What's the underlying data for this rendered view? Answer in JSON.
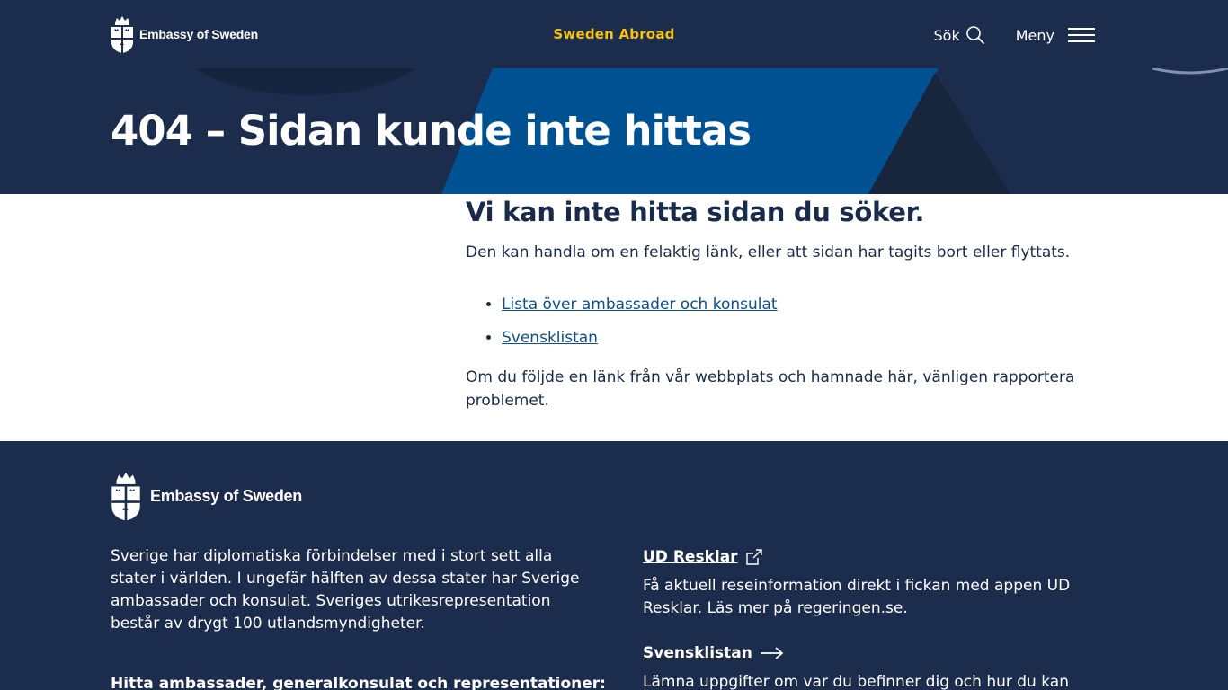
{
  "header": {
    "brand_name": "Embassy of Sweden",
    "center_link": "Sweden Abroad",
    "search_label": "Sök",
    "menu_label": "Meny"
  },
  "hero": {
    "title": "404 – Sidan kunde inte hittas"
  },
  "main": {
    "heading": "Vi kan inte hitta sidan du söker.",
    "lead": "Den kan handla om en felaktig länk, eller att sidan har tagits bort eller flyttats.",
    "links": [
      {
        "label": "Lista över ambassader och konsulat"
      },
      {
        "label": "Svensklistan"
      }
    ],
    "report_text": "Om du följde en länk från vår webbplats och hamnade här, vänligen rapportera problemet."
  },
  "footer": {
    "brand_name": "Embassy of Sweden",
    "intro": "Sverige har diplomatiska förbindelser med i stort sett alla stater i världen. I ungefär hälften av dessa stater har Sverige ambassader och konsulat. Sveriges utrikesrepresentation består av drygt 100 utlandsmyndigheter.",
    "find_heading": "Hitta ambassader, generalkonsulat och representationer:",
    "ud_resklar": {
      "title": "UD Resklar",
      "text": "Få aktuell reseinformation direkt i fickan med appen UD Resklar. Läs mer på regeringen.se."
    },
    "svensklistan": {
      "title": "Svensklistan",
      "text": "Lämna uppgifter om var du befinner dig och hur du kan nås"
    }
  },
  "colors": {
    "navy": "#1b2c4d",
    "blue": "#005293",
    "yellow": "#f8c30a",
    "link_blue": "#0b4f8c"
  }
}
